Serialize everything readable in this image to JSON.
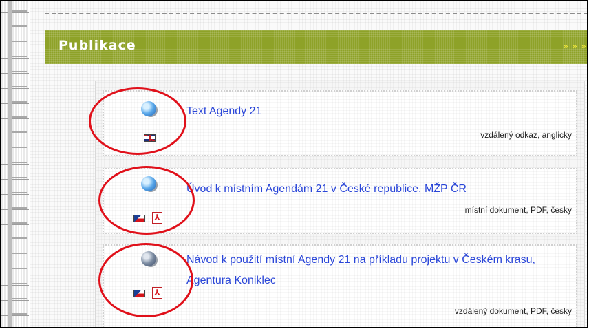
{
  "header": {
    "title": "Publikace",
    "arrows": "» » »"
  },
  "items": [
    {
      "title": "Text Agendy 21",
      "meta": "vzdálený odkaz, anglicky",
      "icons": [
        "globe-icon",
        "uk-flag-icon"
      ]
    },
    {
      "title": "Úvod k místním Agendám 21 v České republice, MŽP ČR",
      "meta": "místní dokument, PDF, česky",
      "icons": [
        "globe-icon",
        "czech-flag-icon",
        "pdf-icon"
      ]
    },
    {
      "title": "Návod k použití místní Agendy 21 na příkladu projektu v Českém krasu, Agentura Koniklec",
      "meta": "vzdálený dokument, PDF, česky",
      "icons": [
        "globe-document-icon",
        "czech-flag-icon",
        "pdf-icon"
      ]
    }
  ],
  "colors": {
    "header_bg": "#8ea228",
    "header_text": "#ffffff",
    "arrows": "#f3ea3a",
    "link": "#2a46d8",
    "annotation_circle": "#e0101a"
  }
}
